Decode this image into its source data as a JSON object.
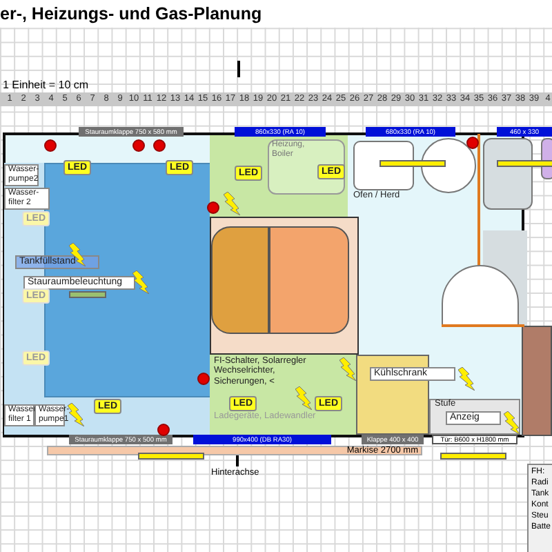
{
  "title": "er-, Heizungs- und Gas-Planung",
  "scale_note": "1 Einheit = 10 cm",
  "ruler": [
    "1",
    "2",
    "3",
    "4",
    "5",
    "6",
    "7",
    "8",
    "9",
    "10",
    "11",
    "12",
    "13",
    "14",
    "15",
    "16",
    "17",
    "18",
    "19",
    "20",
    "21",
    "22",
    "23",
    "24",
    "25",
    "26",
    "27",
    "28",
    "29",
    "30",
    "31",
    "32",
    "33",
    "34",
    "35",
    "36",
    "37",
    "38",
    "39",
    "4"
  ],
  "wall_labels": [
    {
      "text": "Stauraumklappe 750 x 580 mm",
      "kind": "hatch"
    },
    {
      "text": "860x330 (RA 10)",
      "kind": "window"
    },
    {
      "text": "680x330 (RA 10)",
      "kind": "window"
    },
    {
      "text": "460 x 330",
      "kind": "window"
    },
    {
      "text": "Stauraumklappe 750 x 500 mm",
      "kind": "hatch"
    },
    {
      "text": "990x400 (DB RA30)",
      "kind": "window"
    },
    {
      "text": "Klappe 400 x 400",
      "kind": "hatch"
    },
    {
      "text": "Tür: B600 x H1800 mm",
      "kind": "door"
    }
  ],
  "leds": [
    {
      "text": "LED",
      "faded": false
    },
    {
      "text": "LED",
      "faded": false
    },
    {
      "text": "LED",
      "faded": false
    },
    {
      "text": "LED",
      "faded": false
    },
    {
      "text": "LED",
      "faded": true
    },
    {
      "text": "LED",
      "faded": true
    },
    {
      "text": "LED",
      "faded": true
    },
    {
      "text": "LED",
      "faded": false
    },
    {
      "text": "LED",
      "faded": false
    },
    {
      "text": "LED",
      "faded": false
    }
  ],
  "labels": [
    {
      "text": "Wasser-\npumpe2",
      "kind": "box"
    },
    {
      "text": "Wasser-\nfilter 2",
      "kind": "box"
    },
    {
      "text": "Tankfüllstand",
      "kind": "tinted"
    },
    {
      "text": "Stauraumbeleuchtung",
      "kind": "box"
    },
    {
      "text": "Wasser\nfilter 1",
      "kind": "box"
    },
    {
      "text": "Wasser-\npumpe1",
      "kind": "box"
    },
    {
      "text": "Heizung,\nBoiler",
      "kind": "soft"
    },
    {
      "text": "Ofen / Herd",
      "kind": "plain"
    },
    {
      "text": "FI-Schalter, Solarregler\nWechselrichter,\nSicherungen, <",
      "kind": "plain"
    },
    {
      "text": "Ladegeräte, Ladewandler",
      "kind": "faint"
    },
    {
      "text": "Kühlschrank",
      "kind": "box"
    },
    {
      "text": "Stufe",
      "kind": "plain"
    },
    {
      "text": "Anzeig",
      "kind": "box"
    }
  ],
  "awning": "Markise 2700 mm",
  "axle": "Hinterachse",
  "legend": [
    "FH:",
    "Radi",
    "Tank",
    "Kont",
    "Steu",
    "Batte"
  ]
}
